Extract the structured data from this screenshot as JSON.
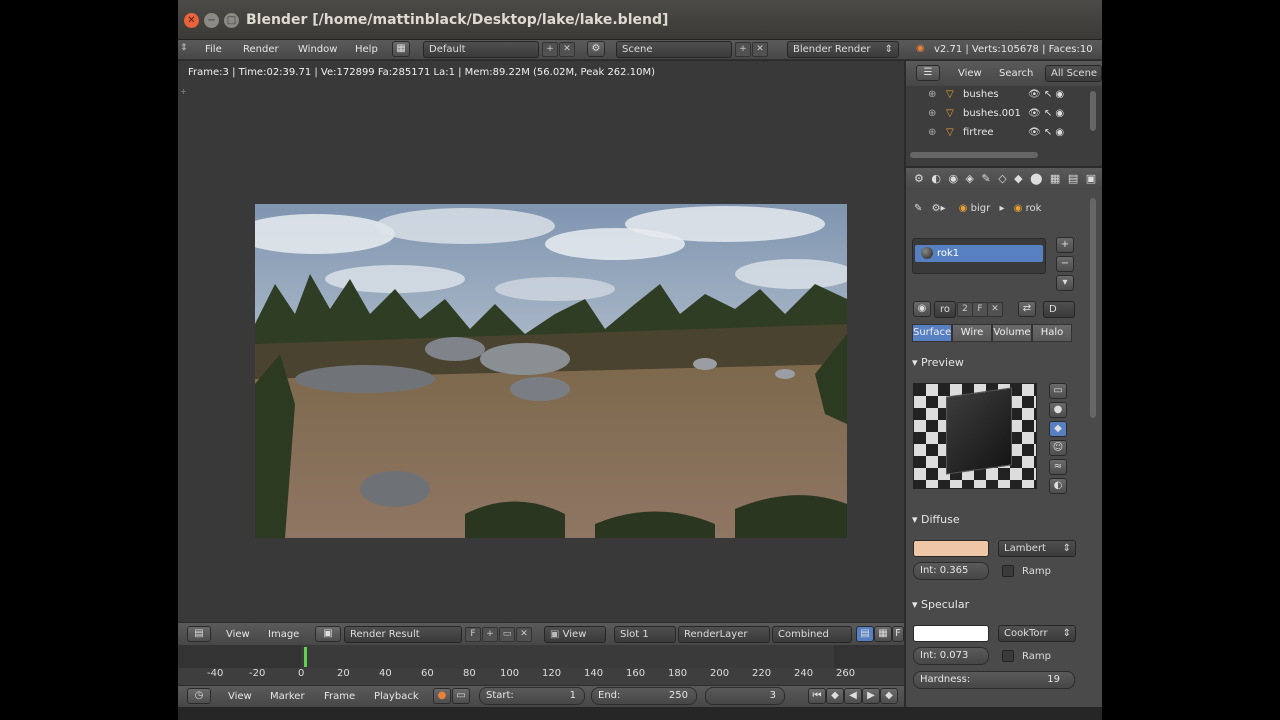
{
  "window": {
    "title": "Blender [/home/mattinblack/Desktop/lake/lake.blend]",
    "close": "✕",
    "minimize": "−",
    "maximize": "□"
  },
  "header": {
    "menus": [
      "File",
      "Render",
      "Window",
      "Help"
    ],
    "layout": "Default",
    "scene": "Scene",
    "engine": "Blender Render",
    "info": "v2.71 | Verts:105678 | Faces:10"
  },
  "image_editor": {
    "stats": "Frame:3 | Time:02:39.71 | Ve:172899 Fa:285171 La:1 | Mem:89.22M (56.02M, Peak 262.10M)",
    "menus": [
      "View",
      "Image"
    ],
    "image_name": "Render Result",
    "f_label": "F",
    "view_label": "View",
    "slot": "Slot 1",
    "render_layer": "RenderLayer",
    "pass": "Combined"
  },
  "timeline": {
    "ticks": [
      "-40",
      "-20",
      "0",
      "20",
      "40",
      "60",
      "80",
      "100",
      "120",
      "140",
      "160",
      "180",
      "200",
      "220",
      "240",
      "260"
    ],
    "menus": [
      "View",
      "Marker",
      "Frame",
      "Playback"
    ],
    "start_label": "Start:",
    "start_value": "1",
    "end_label": "End:",
    "end_value": "250",
    "current_frame": "3"
  },
  "outliner": {
    "menus": [
      "View",
      "Search"
    ],
    "scope": "All Scene",
    "items": [
      "bushes",
      "bushes.001",
      "firtree"
    ]
  },
  "properties": {
    "context": {
      "object": "bigr",
      "material": "rok"
    },
    "material_slot": "rok1",
    "material_name": "ro",
    "users": "2",
    "fake_label": "F",
    "data_label": "D",
    "tabs": [
      "Surface",
      "Wire",
      "Volume",
      "Halo"
    ],
    "active_tab": "Surface",
    "preview_label": "Preview",
    "diffuse": {
      "label": "Diffuse",
      "color": "#efc6a6",
      "shader": "Lambert",
      "intensity": "Int: 0.365",
      "ramp": "Ramp"
    },
    "specular": {
      "label": "Specular",
      "color": "#ffffff",
      "shader": "CookTorr",
      "intensity": "Int: 0.073",
      "ramp": "Ramp",
      "hardness_label": "Hardness:",
      "hardness_value": "19"
    }
  },
  "colors": {
    "accent_blue": "#5680c2",
    "background": "#393939"
  }
}
